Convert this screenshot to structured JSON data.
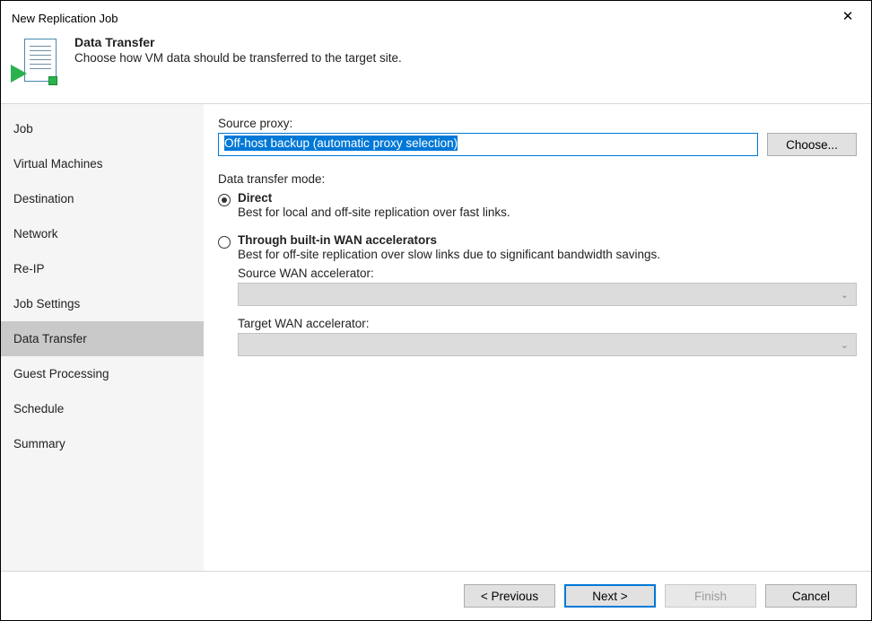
{
  "window": {
    "title": "New Replication Job"
  },
  "header": {
    "title": "Data Transfer",
    "subtitle": "Choose how VM data should be transferred to the target site."
  },
  "sidebar": {
    "items": [
      {
        "label": "Job"
      },
      {
        "label": "Virtual Machines"
      },
      {
        "label": "Destination"
      },
      {
        "label": "Network"
      },
      {
        "label": "Re-IP"
      },
      {
        "label": "Job Settings"
      },
      {
        "label": "Data Transfer",
        "active": true
      },
      {
        "label": "Guest Processing"
      },
      {
        "label": "Schedule"
      },
      {
        "label": "Summary"
      }
    ]
  },
  "content": {
    "source_proxy_label": "Source proxy:",
    "source_proxy_value": "Off-host backup (automatic proxy selection)",
    "choose_label": "Choose...",
    "mode_label": "Data transfer mode:",
    "direct_title": "Direct",
    "direct_desc": "Best for local and off-site replication over fast links.",
    "wan_title": "Through built-in WAN accelerators",
    "wan_desc": "Best for off-site replication over slow links due to significant bandwidth savings.",
    "source_wan_label": "Source WAN accelerator:",
    "target_wan_label": "Target WAN accelerator:"
  },
  "footer": {
    "previous": "< Previous",
    "next": "Next >",
    "finish": "Finish",
    "cancel": "Cancel"
  }
}
